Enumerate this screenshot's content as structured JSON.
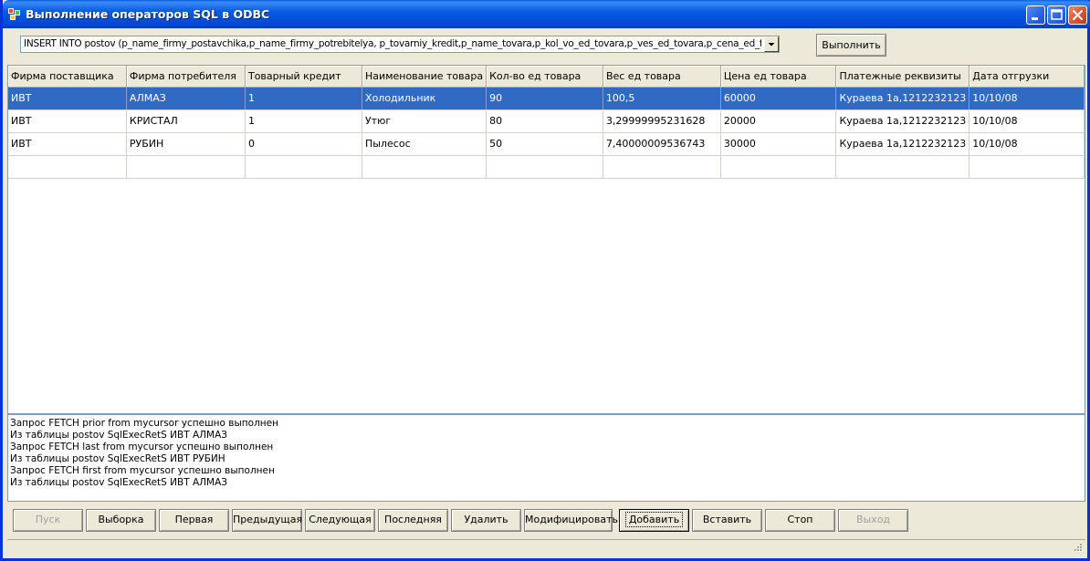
{
  "window": {
    "title": "Выполнение операторов SQL в ODBC"
  },
  "query": {
    "value": "INSERT INTO postov (p_name_firmy_postavchika,p_name_firmy_potrebitelya, p_tovarniy_kredit,p_name_tovara,p_kol_vo_ed_tovara,p_ves_ed_tovara,p_cena_ed_tovar",
    "execute_label": "Выполнить"
  },
  "table": {
    "columns": [
      "Фирма поставщика",
      "Фирма потребителя",
      "Товарный кредит",
      "Наименование товара",
      "Кол-во ед товара",
      "Вес ед товара",
      "Цена ед товара",
      "Платежные реквизиты",
      "Дата отгрузки"
    ],
    "rows": [
      [
        "ИВТ",
        "АЛМАЗ",
        "1",
        "Холодильник",
        "90",
        "100,5",
        "60000",
        "Кураева 1а,1212232123",
        "10/10/08"
      ],
      [
        "ИВТ",
        "КРИСТАЛ",
        "1",
        "Утюг",
        "80",
        "3,29999995231628",
        "20000",
        "Кураева 1а,1212232123",
        "10/10/08"
      ],
      [
        "ИВТ",
        "РУБИН",
        "0",
        "Пылесос",
        "50",
        "7,40000009536743",
        "30000",
        "Кураева 1а,1212232123",
        "10/10/08"
      ],
      [
        "",
        "",
        "",
        "",
        "",
        "",
        "",
        "",
        ""
      ]
    ],
    "selected_row": 0
  },
  "log": [
    "Запрос FETCH prior from mycursor успешно выполнен",
    "Из таблицы postov SqlExecRetS ИВТ АЛМАЗ",
    "Запрос FETCH last from mycursor успешно выполнен",
    "Из таблицы postov SqlExecRetS ИВТ РУБИН",
    "Запрос FETCH first from mycursor успешно выполнен",
    "Из таблицы postov SqlExecRetS ИВТ АЛМАЗ"
  ],
  "buttons": {
    "start": "Пуск",
    "select": "Выборка",
    "first": "Первая",
    "prev": "Предыдущая",
    "next": "Следующая",
    "last": "Последняя",
    "delete": "Удалить",
    "modify": "Модифицировать",
    "add": "Добавить",
    "insert": "Вставить",
    "stop": "Стоп",
    "exit": "Выход"
  },
  "icons": {
    "app": "app-icon",
    "minimize": "minimize-icon",
    "maximize": "maximize-icon",
    "close": "close-icon",
    "dropdown": "chevron-down-icon"
  },
  "colors": {
    "titlebar": "#0b5be0",
    "selection": "#316ac5",
    "close": "#d8502d"
  }
}
